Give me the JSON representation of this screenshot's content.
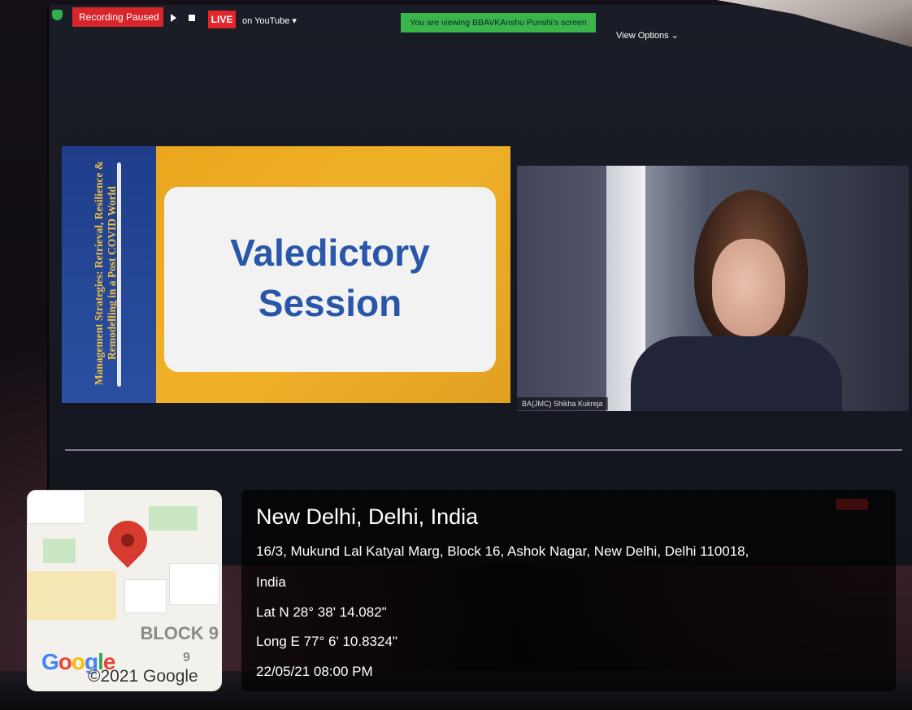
{
  "zoom": {
    "recording_label": "Recording Paused",
    "live_label": "LIVE",
    "live_destination": "on YouTube ▾",
    "viewing_banner": "You are viewing BBAVKAnshu Punshi's screen",
    "view_options": "View Options ⌄"
  },
  "slide": {
    "vertical_title": "Management Strategies: Retrieval, Resilience & Remodelling in a Post COVID World",
    "heading_line1": "Valedictory",
    "heading_line2": "Session"
  },
  "speaker": {
    "name_label": "BA(JMC) Shikha Kukreja"
  },
  "geotag": {
    "city": "New Delhi, Delhi, India",
    "address_line1": "16/3, Mukund Lal Katyal Marg, Block 16, Ashok Nagar, New Delhi, Delhi 110018,",
    "address_line2": "India",
    "latitude": "Lat N 28° 38' 14.082\"",
    "longitude": "Long E 77° 6' 10.8324\"",
    "datetime": "22/05/21 08:00 PM",
    "map_label": "BLOCK 9",
    "map_number": "9",
    "map_copyright": "©2021 Google"
  },
  "colors": {
    "recording_red": "#d8252c",
    "banner_green": "#39b54a",
    "slide_orange": "#f0b129",
    "slide_blue": "#2856a8",
    "pin_red": "#d73a2f"
  }
}
